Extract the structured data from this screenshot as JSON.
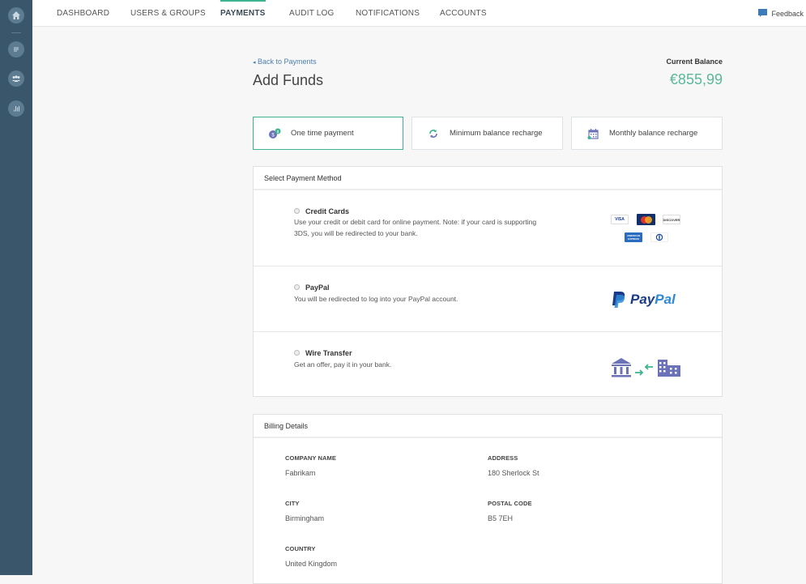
{
  "sidebar": {
    "icons": [
      "home-icon",
      "chat-icon",
      "users-icon",
      "chart-icon"
    ]
  },
  "nav": {
    "items": [
      {
        "label": "DASHBOARD",
        "active": false
      },
      {
        "label": "USERS & GROUPS",
        "active": false
      },
      {
        "label": "PAYMENTS",
        "active": true
      },
      {
        "label": "AUDIT LOG",
        "active": false
      },
      {
        "label": "NOTIFICATIONS",
        "active": false
      },
      {
        "label": "ACCOUNTS",
        "active": false
      }
    ],
    "feedback": "Feedback"
  },
  "header": {
    "back_link": "Back to Payments",
    "title": "Add Funds",
    "balance_label": "Current Balance",
    "balance_value": "€855,99"
  },
  "payment_types": [
    {
      "label": "One time payment",
      "icon": "coins-icon",
      "selected": true
    },
    {
      "label": "Minimum balance recharge",
      "icon": "refresh-icon",
      "selected": false
    },
    {
      "label": "Monthly balance recharge",
      "icon": "calendar-icon",
      "selected": false
    }
  ],
  "payment_method": {
    "header": "Select Payment Method",
    "methods": [
      {
        "title": "Credit Cards",
        "description": "Use your credit or debit card for online payment. Note: if your card is supporting 3DS, you will be redirected to your bank.",
        "logos": [
          "VISA",
          "MasterCard",
          "DISCOVER",
          "AMERICAN EXPRESS",
          "Diners"
        ]
      },
      {
        "title": "PayPal",
        "description": "You will be redirected to log into your PayPal account.",
        "logo_text_1": "Pay",
        "logo_text_2": "Pal"
      },
      {
        "title": "Wire Transfer",
        "description": "Get an offer, pay it in your bank."
      }
    ]
  },
  "billing": {
    "header": "Billing Details",
    "fields": [
      {
        "label": "COMPANY NAME",
        "value": "Fabrikam"
      },
      {
        "label": "ADDRESS",
        "value": "180 Sherlock St"
      },
      {
        "label": "CITY",
        "value": "Birmingham"
      },
      {
        "label": "POSTAL CODE",
        "value": "B5 7EH"
      },
      {
        "label": "COUNTRY",
        "value": "United Kingdom"
      }
    ]
  },
  "colors": {
    "accent": "#3db38f",
    "sidebar": "#3a566b",
    "balance": "#5bb89b",
    "link": "#4a7fb0"
  }
}
